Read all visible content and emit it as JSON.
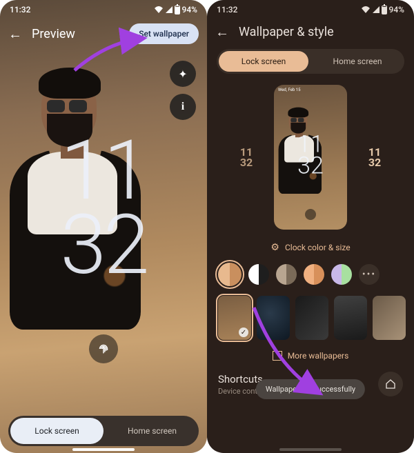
{
  "status": {
    "time": "11:32",
    "battery": "94%"
  },
  "left": {
    "title": "Preview",
    "set_wallpaper": "Set wallpaper",
    "clock_hh": "11",
    "clock_mm": "32",
    "tabs": {
      "lock": "Lock screen",
      "home": "Home screen"
    }
  },
  "right": {
    "title": "Wallpaper & style",
    "tabs": {
      "lock": "Lock screen",
      "home": "Home screen"
    },
    "clock_hh": "11",
    "clock_mm": "32",
    "mini_status": "Wed, Feb 15",
    "clock_color_size": "Clock color & size",
    "more_wallpapers": "More wallpapers",
    "shortcuts_title": "Shortcuts",
    "shortcuts_sub": "Device controls",
    "toast": "Wallpaper set successfully",
    "swatches": [
      {
        "left": "#e8b98e",
        "right": "#c98f5e"
      },
      {
        "left": "#ffffff",
        "right": "#1e1e1e"
      },
      {
        "left": "#b8a590",
        "right": "#7a6a58"
      },
      {
        "left": "#f0b080",
        "right": "#d8905a"
      },
      {
        "left": "#c8b8e8",
        "right": "#a8e0a0"
      }
    ]
  }
}
